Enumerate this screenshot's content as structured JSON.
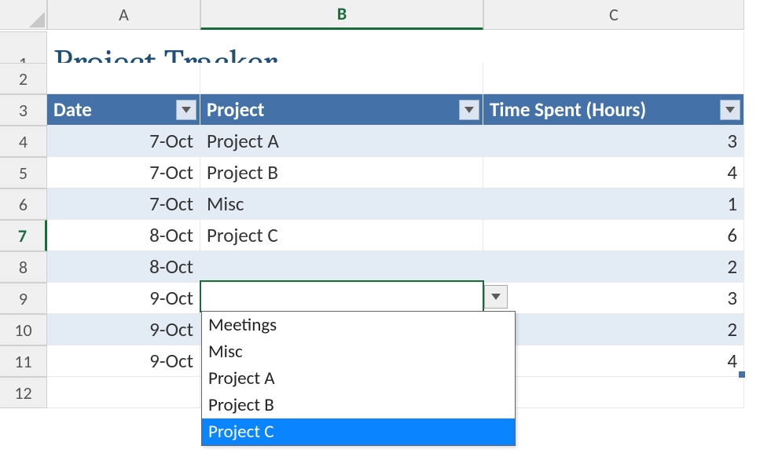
{
  "columns": [
    "A",
    "B",
    "C"
  ],
  "active_column_index": 1,
  "title": "Project Tracker",
  "title_row": 1,
  "blank_row": 2,
  "header_row": 3,
  "headers": [
    "Date",
    "Project",
    "Time Spent (Hours)"
  ],
  "rows": [
    {
      "num": "4",
      "date": "7-Oct",
      "project": "Project A",
      "hours": "3",
      "band": "even"
    },
    {
      "num": "5",
      "date": "7-Oct",
      "project": "Project B",
      "hours": "4",
      "band": "odd"
    },
    {
      "num": "6",
      "date": "7-Oct",
      "project": "Misc",
      "hours": "1",
      "band": "even"
    },
    {
      "num": "7",
      "date": "8-Oct",
      "project": "Project C",
      "hours": "6",
      "band": "odd",
      "active": true
    },
    {
      "num": "8",
      "date": "8-Oct",
      "project": "",
      "hours": "2",
      "band": "even"
    },
    {
      "num": "9",
      "date": "9-Oct",
      "project": "",
      "hours": "3",
      "band": "odd"
    },
    {
      "num": "10",
      "date": "9-Oct",
      "project": "",
      "hours": "2",
      "band": "even"
    },
    {
      "num": "11",
      "date": "9-Oct",
      "project": "",
      "hours": "4",
      "band": "odd",
      "last": true
    }
  ],
  "empty_row_after": "12",
  "active_row": "7",
  "dropdown": {
    "items": [
      "Meetings",
      "Misc",
      "Project A",
      "Project B",
      "Project C"
    ],
    "selected_index": 4
  }
}
